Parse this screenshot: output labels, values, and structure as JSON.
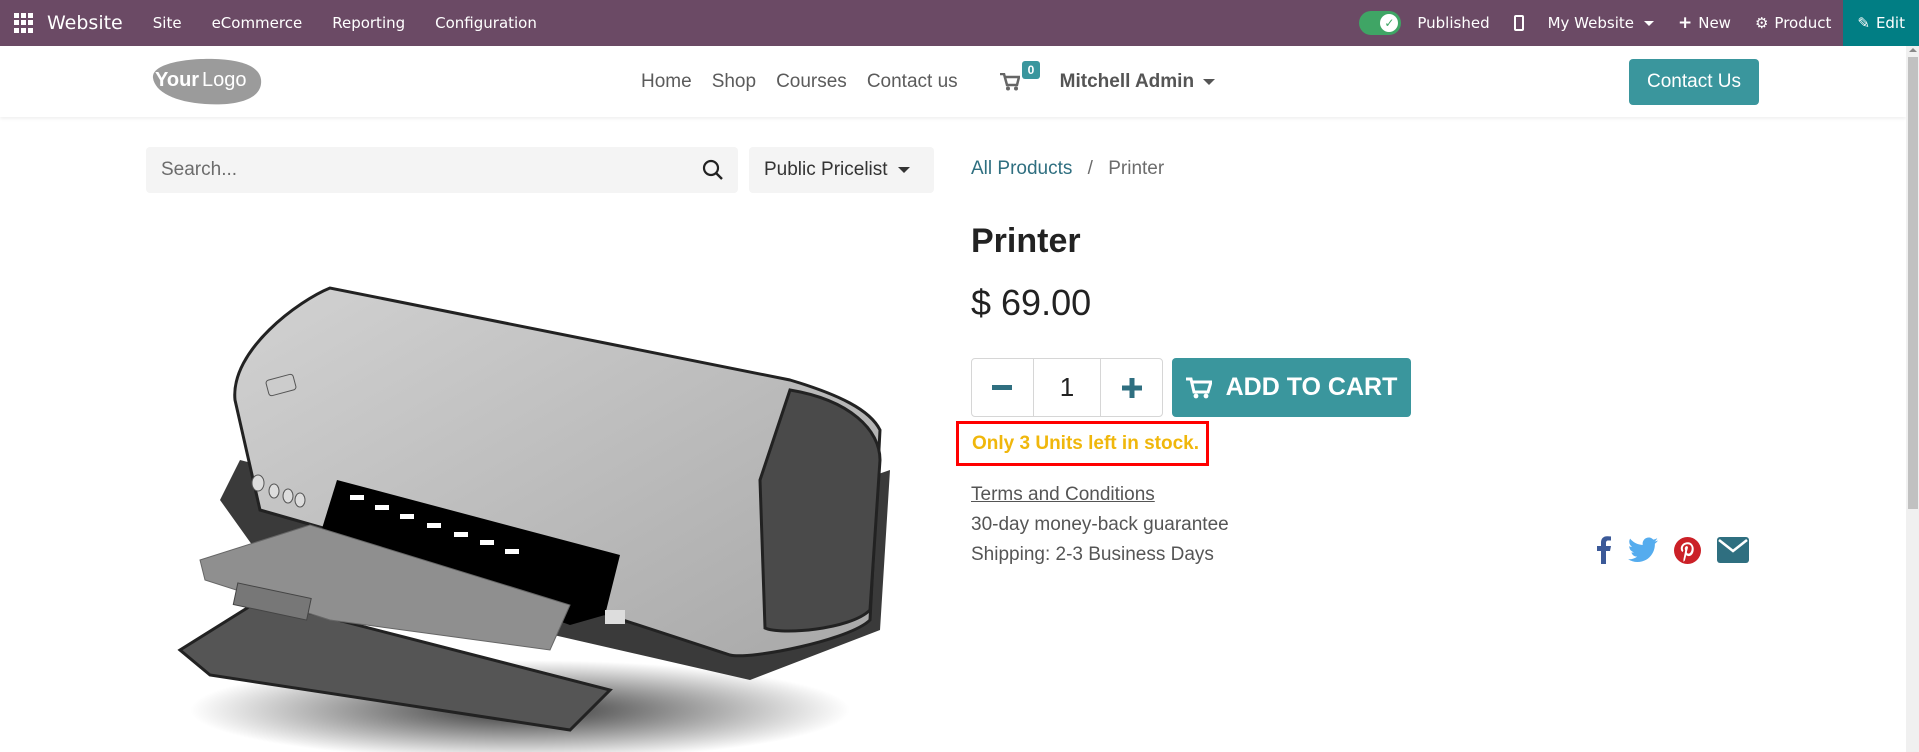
{
  "topbar": {
    "brand": "Website",
    "menus": [
      "Site",
      "eCommerce",
      "Reporting",
      "Configuration"
    ],
    "published_label": "Published",
    "published": true,
    "website_label": "My Website",
    "new_label": "New",
    "product_label": "Product",
    "edit_label": "Edit"
  },
  "header": {
    "logo_text_bold": "Your",
    "logo_text": "Logo",
    "nav": [
      "Home",
      "Shop",
      "Courses",
      "Contact us"
    ],
    "cart_count": "0",
    "user": "Mitchell Admin",
    "contact_button": "Contact Us"
  },
  "search": {
    "placeholder": "Search...",
    "pricelist": "Public Pricelist"
  },
  "breadcrumb": {
    "parent": "All Products",
    "separator": "/",
    "current": "Printer"
  },
  "product": {
    "name": "Printer",
    "price": "$ 69.00",
    "quantity": "1",
    "add_to_cart": "ADD TO CART",
    "stock_message": "Only 3 Units left in stock.",
    "terms": "Terms and Conditions",
    "guarantee": "30-day money-back guarantee",
    "shipping": "Shipping: 2-3 Business Days"
  },
  "social": [
    "facebook-icon",
    "twitter-icon",
    "pinterest-icon",
    "email-icon"
  ],
  "colors": {
    "topbar": "#6b4a65",
    "edit": "#017e84",
    "primary": "#3a969d",
    "stock_text": "#f0b70c",
    "highlight_border": "#ff0000",
    "published_toggle": "#3fa565"
  }
}
